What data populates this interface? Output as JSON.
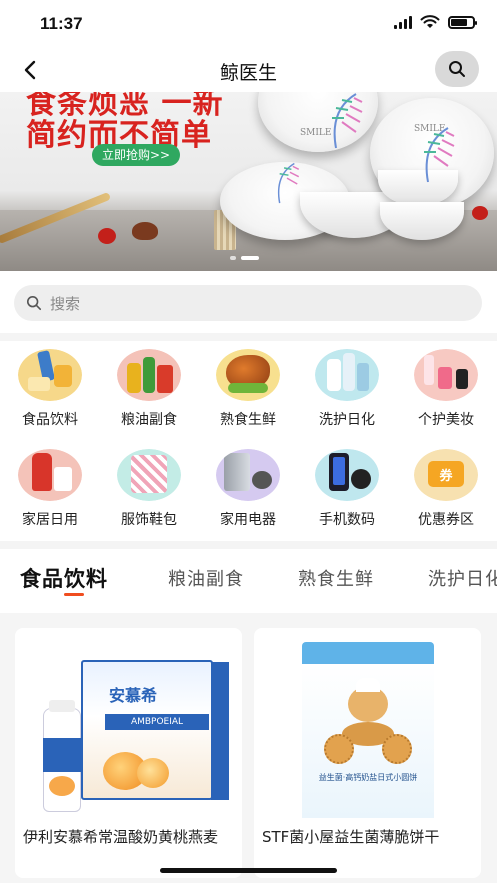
{
  "status_bar": {
    "time": "11:37"
  },
  "nav": {
    "title": "鲸医生",
    "back_icon": "chevron-left-icon",
    "search_icon": "search-icon"
  },
  "banner": {
    "headline1": "食条烦恶 一新",
    "headline2": "简约而不简单",
    "cta": "立即抢购>>",
    "plate_text": "SMILE",
    "slide_count": 2,
    "active_slide": 2
  },
  "search": {
    "placeholder": "搜索"
  },
  "categories": [
    {
      "label": "食品饮料",
      "icon": "food-drink-icon",
      "color": "#f6d88a"
    },
    {
      "label": "粮油副食",
      "icon": "grain-oil-icon",
      "color": "#f4c2b8"
    },
    {
      "label": "熟食生鲜",
      "icon": "cooked-fresh-icon",
      "color": "#f7e08f"
    },
    {
      "label": "洗护日化",
      "icon": "toiletries-icon",
      "color": "#bfe8ee"
    },
    {
      "label": "个护美妆",
      "icon": "cosmetics-icon",
      "color": "#f7c9c2"
    },
    {
      "label": "家居日用",
      "icon": "household-icon",
      "color": "#f4c3b9"
    },
    {
      "label": "服饰鞋包",
      "icon": "apparel-icon",
      "color": "#c3ece6"
    },
    {
      "label": "家用电器",
      "icon": "appliance-icon",
      "color": "#d5caf0"
    },
    {
      "label": "手机数码",
      "icon": "phone-digital-icon",
      "color": "#bfe7ee"
    },
    {
      "label": "优惠券区",
      "icon": "coupon-icon",
      "color": "#f7e1b0"
    }
  ],
  "coupon_badge": "券",
  "tabs": [
    "食品饮料",
    "粮油副食",
    "熟食生鲜",
    "洗护日化"
  ],
  "active_tab": 0,
  "products": [
    {
      "name": "伊利安慕希常温酸奶黄桃燕麦",
      "brand": "安慕希",
      "brand_sub": "AMBPOEIAL",
      "accent": "#2a63b8"
    },
    {
      "name": "STF菌小屋益生菌薄脆饼干",
      "brand": "益生菌·高钙奶盐日式小圆饼",
      "accent": "#5fb3e8"
    }
  ],
  "colors": {
    "accent": "#f04d1f",
    "banner_red": "#d8231f",
    "cta_green": "#2fa860"
  }
}
